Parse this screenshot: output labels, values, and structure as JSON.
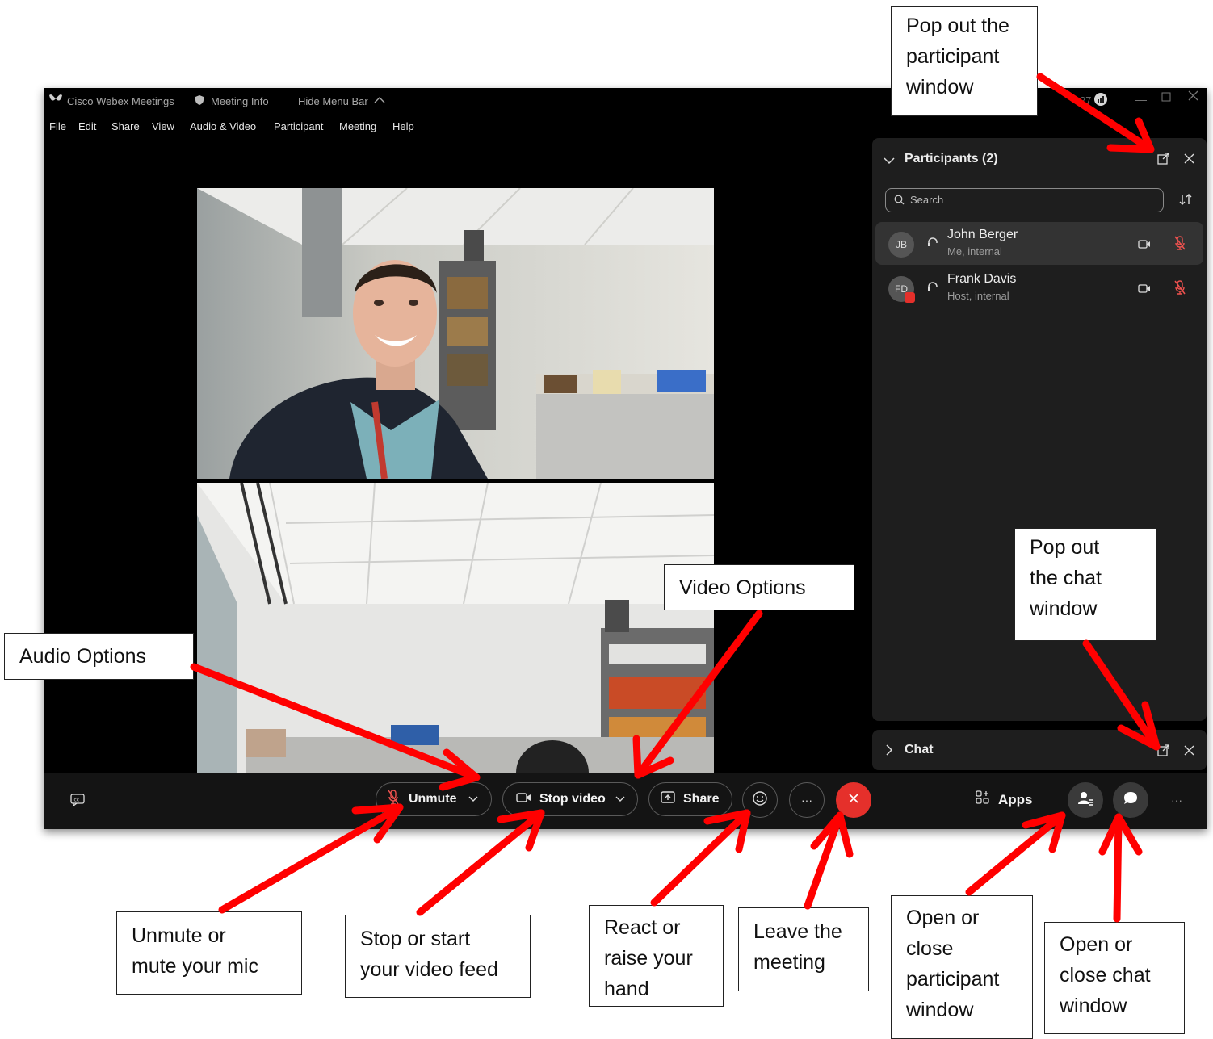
{
  "window": {
    "app_title": "Cisco Webex Meetings",
    "meeting_info": "Meeting Info",
    "hide_menu_bar": "Hide Menu Bar",
    "menu": [
      "File",
      "Edit",
      "Share",
      "View",
      "Audio & Video",
      "Participant",
      "Meeting",
      "Help"
    ]
  },
  "participants_panel": {
    "title": "Participants (2)",
    "search_placeholder": "Search",
    "people": [
      {
        "initials": "JB",
        "name": "John Berger",
        "role": "Me, internal"
      },
      {
        "initials": "FD",
        "name": "Frank Davis",
        "role": "Host, internal"
      }
    ]
  },
  "chat_panel": {
    "title": "Chat"
  },
  "controls": {
    "unmute": "Unmute",
    "stop_video": "Stop video",
    "share": "Share",
    "more": "···",
    "apps": "Apps",
    "overflow": "···"
  },
  "annotations": {
    "pop_participant": [
      "Pop out the",
      "participant",
      "window"
    ],
    "pop_chat": [
      "Pop out",
      "the chat",
      "window"
    ],
    "video_options": "Video Options",
    "audio_options": "Audio Options",
    "unmute_mic": [
      "Unmute or",
      "mute your mic"
    ],
    "stop_start_video": [
      "Stop or start",
      "your video feed"
    ],
    "react": [
      "React or",
      "raise your",
      "hand"
    ],
    "leave": [
      "Leave the",
      "meeting"
    ],
    "participant_window": [
      "Open or",
      "close",
      "participant",
      "window"
    ],
    "chat_window": [
      "Open or",
      "close chat",
      "window"
    ]
  },
  "colors": {
    "leave_red": "#e5302b",
    "arrow_red": "#ff0000",
    "mute_red": "#f0524f"
  }
}
